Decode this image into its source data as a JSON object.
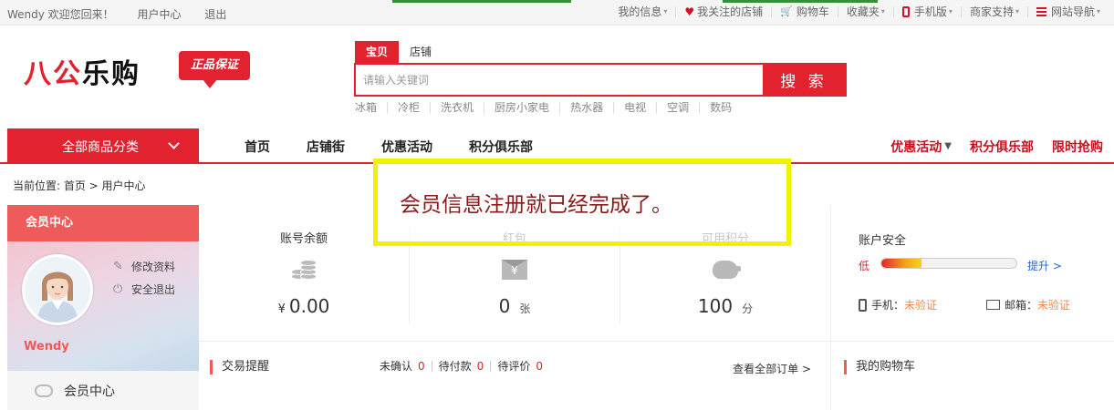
{
  "topbar": {
    "welcome": "Wendy 欢迎您回来！",
    "user_center": "用户中心",
    "logout": "退出",
    "my_info": "我的信息",
    "followed_shops": "我关注的店铺",
    "cart": "购物车",
    "favorites": "收藏夹",
    "mobile": "手机版",
    "merchant_support": "商家支持",
    "site_nav": "网站导航"
  },
  "header": {
    "logo_text_1": "八公",
    "logo_text_2": "乐购",
    "badge": "正品保证"
  },
  "search": {
    "tabs": [
      "宝贝",
      "店铺"
    ],
    "placeholder": "请输入关键词",
    "button": "搜 索",
    "hot": [
      "冰箱",
      "冷柜",
      "洗衣机",
      "厨房小家电",
      "热水器",
      "电视",
      "空调",
      "数码"
    ]
  },
  "nav": {
    "all_categories": "全部商品分类",
    "links": [
      "首页",
      "店铺街",
      "优惠活动",
      "积分俱乐部"
    ],
    "right": [
      "优惠活动",
      "积分俱乐部",
      "限时抢购"
    ]
  },
  "breadcrumb": "当前位置: 首页 > 用户中心",
  "sidebar": {
    "title": "会员中心",
    "edit_profile": "修改资料",
    "safe_logout": "安全退出",
    "username": "Wendy",
    "menu_item": "会员中心"
  },
  "stats": [
    {
      "label": "账号余额",
      "currency": "¥",
      "value": "0.00",
      "unit": ""
    },
    {
      "label": "红包",
      "currency": "",
      "value": "0",
      "unit": "张"
    },
    {
      "label": "可用积分",
      "currency": "",
      "value": "100",
      "unit": "分"
    }
  ],
  "security": {
    "title": "账户安全",
    "level": "低",
    "level_fraction": 0.3,
    "upgrade": "提升 >",
    "phone_label": "手机：",
    "phone_status": "未验证",
    "email_label": "邮箱：",
    "email_status": "未验证"
  },
  "trade": {
    "title": "交易提醒",
    "unconfirmed_label": "未确认",
    "unconfirmed": "0",
    "unpaid_label": "待付款",
    "unpaid": "0",
    "unreviewed_label": "待评价",
    "unreviewed": "0",
    "all_orders": "查看全部订单 >"
  },
  "cart_box": {
    "title": "我的购物车"
  },
  "overlay": {
    "text": "会员信息注册就已经完成了。"
  }
}
